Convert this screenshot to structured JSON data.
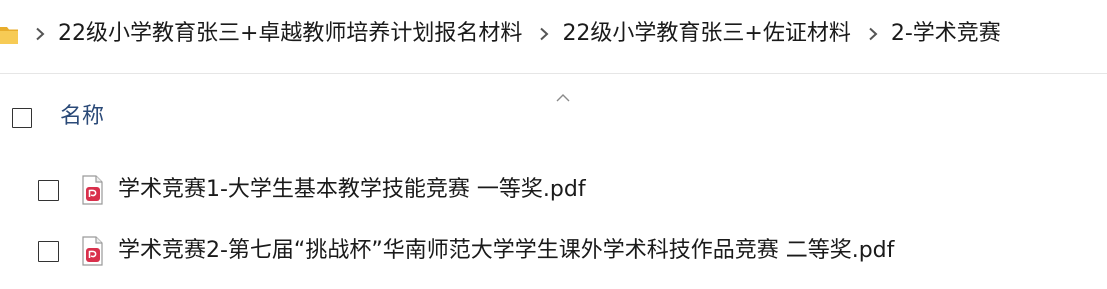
{
  "breadcrumb": {
    "folder_icon": "folder-icon",
    "separator_icon": "chevron-right-icon",
    "items": [
      {
        "label": "22级小学教育张三+卓越教师培养计划报名材料"
      },
      {
        "label": "22级小学教育张三+佐证材料"
      },
      {
        "label": "2-学术竞赛"
      }
    ]
  },
  "list": {
    "sort_icon": "sort-ascending-caret-icon",
    "column_name": "名称",
    "files": [
      {
        "name": "学术竞赛1-大学生基本教学技能竞赛 一等奖.pdf",
        "icon": "pdf-file-icon",
        "checked": false
      },
      {
        "name": "学术竞赛2-第七届“挑战杯”华南师范大学学生课外学术科技作品竞赛 二等奖.pdf",
        "icon": "pdf-file-icon",
        "checked": false
      }
    ]
  },
  "colors": {
    "folder": "#f2c24f",
    "header_text": "#2b4a78",
    "pdf_accent": "#d9304c",
    "divider": "#e6e6e6"
  }
}
